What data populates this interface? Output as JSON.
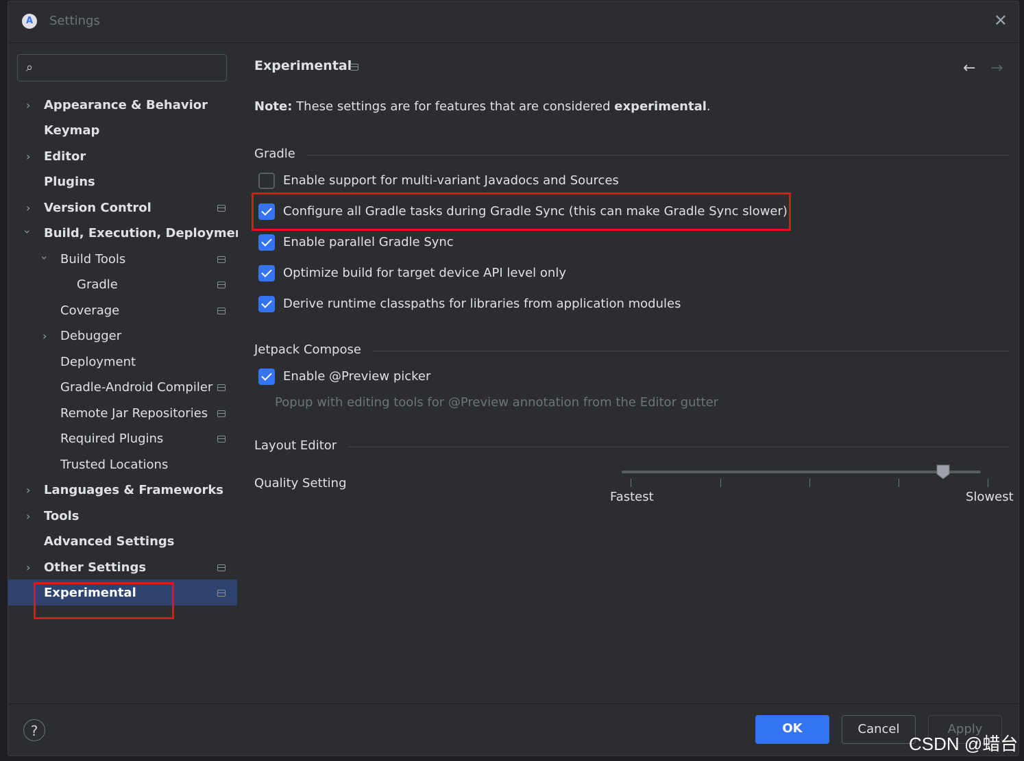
{
  "window": {
    "title": "Settings"
  },
  "search": {
    "value": ""
  },
  "sidebar": {
    "items": [
      {
        "label": "Appearance & Behavior",
        "bold": true
      },
      {
        "label": "Keymap",
        "bold": true
      },
      {
        "label": "Editor",
        "bold": true
      },
      {
        "label": "Plugins",
        "bold": true
      },
      {
        "label": "Version Control",
        "bold": true
      },
      {
        "label": "Build, Execution, Deployment",
        "bold": true
      },
      {
        "label": "Build Tools"
      },
      {
        "label": "Gradle"
      },
      {
        "label": "Coverage"
      },
      {
        "label": "Debugger"
      },
      {
        "label": "Deployment"
      },
      {
        "label": "Gradle-Android Compiler"
      },
      {
        "label": "Remote Jar Repositories"
      },
      {
        "label": "Required Plugins"
      },
      {
        "label": "Trusted Locations"
      },
      {
        "label": "Languages & Frameworks",
        "bold": true
      },
      {
        "label": "Tools",
        "bold": true
      },
      {
        "label": "Advanced Settings",
        "bold": true
      },
      {
        "label": "Other Settings",
        "bold": true
      },
      {
        "label": "Experimental",
        "bold": true,
        "selected": true
      }
    ]
  },
  "content": {
    "title": "Experimental",
    "note_prefix": "Note:",
    "note_text": " These settings are for features that are considered ",
    "note_bold": "experimental",
    "note_suffix": ".",
    "gradle": {
      "heading": "Gradle",
      "options": [
        {
          "label": "Enable support for multi-variant Javadocs and Sources",
          "checked": false
        },
        {
          "label": "Configure all Gradle tasks during Gradle Sync (this can make Gradle Sync slower)",
          "checked": true
        },
        {
          "label": "Enable parallel Gradle Sync",
          "checked": true
        },
        {
          "label": "Optimize build for target device API level only",
          "checked": true
        },
        {
          "label": "Derive runtime classpaths for libraries from application modules",
          "checked": true
        }
      ]
    },
    "compose": {
      "heading": "Jetpack Compose",
      "option": {
        "label": "Enable @Preview picker",
        "checked": true
      },
      "hint": "Popup with editing tools for @Preview annotation from the Editor gutter"
    },
    "layout_editor": {
      "heading": "Layout Editor",
      "quality_label": "Quality Setting",
      "min_label": "Fastest",
      "max_label": "Slowest",
      "value_fraction": 0.875
    }
  },
  "footer": {
    "help": "?",
    "ok": "OK",
    "cancel": "Cancel",
    "apply": "Apply"
  },
  "watermark": "CSDN @蜡台",
  "colors": {
    "accent": "#3574f0",
    "highlight": "#e5141a",
    "selection": "#2e436e"
  }
}
